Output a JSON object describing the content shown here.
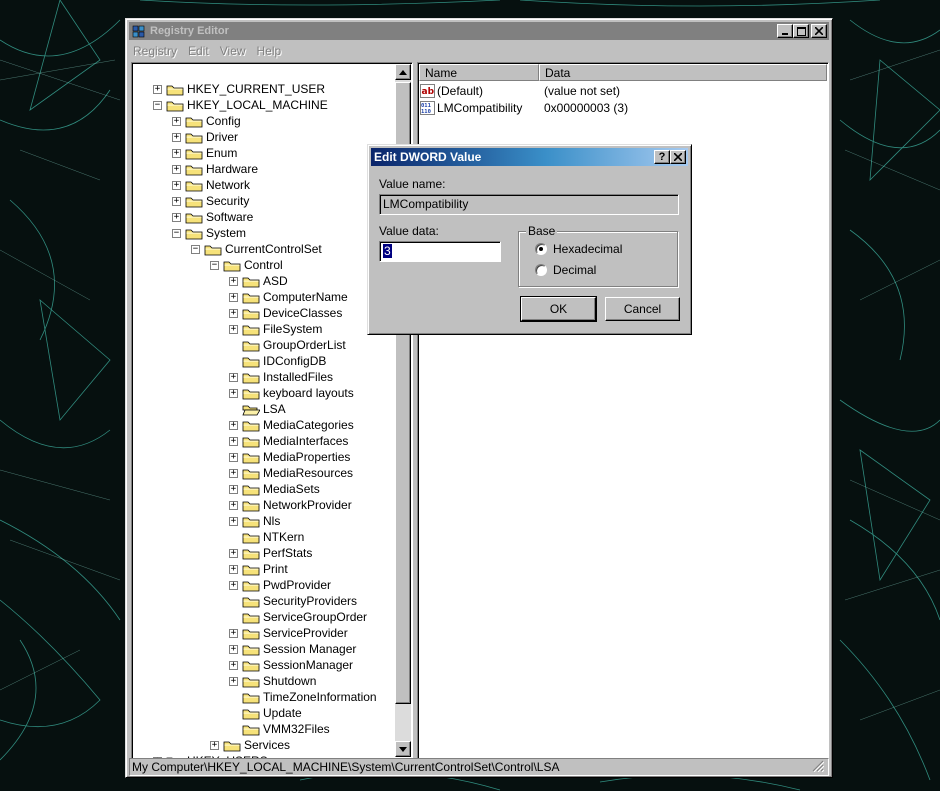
{
  "window": {
    "title": "Registry Editor",
    "menu": [
      "Registry",
      "Edit",
      "View",
      "Help"
    ]
  },
  "tree": {
    "items": [
      {
        "label": "HKEY_CURRENT_USER",
        "level": 0,
        "exp": "+"
      },
      {
        "label": "HKEY_LOCAL_MACHINE",
        "level": 0,
        "exp": "-"
      },
      {
        "label": "Config",
        "level": 1,
        "exp": "+"
      },
      {
        "label": "Driver",
        "level": 1,
        "exp": "+"
      },
      {
        "label": "Enum",
        "level": 1,
        "exp": "+"
      },
      {
        "label": "Hardware",
        "level": 1,
        "exp": "+"
      },
      {
        "label": "Network",
        "level": 1,
        "exp": "+"
      },
      {
        "label": "Security",
        "level": 1,
        "exp": "+"
      },
      {
        "label": "Software",
        "level": 1,
        "exp": "+"
      },
      {
        "label": "System",
        "level": 1,
        "exp": "-"
      },
      {
        "label": "CurrentControlSet",
        "level": 2,
        "exp": "-"
      },
      {
        "label": "Control",
        "level": 3,
        "exp": "-"
      },
      {
        "label": "ASD",
        "level": 4,
        "exp": "+"
      },
      {
        "label": "ComputerName",
        "level": 4,
        "exp": "+"
      },
      {
        "label": "DeviceClasses",
        "level": 4,
        "exp": "+"
      },
      {
        "label": "FileSystem",
        "level": 4,
        "exp": "+"
      },
      {
        "label": "GroupOrderList",
        "level": 4,
        "exp": ""
      },
      {
        "label": "IDConfigDB",
        "level": 4,
        "exp": ""
      },
      {
        "label": "InstalledFiles",
        "level": 4,
        "exp": "+"
      },
      {
        "label": "keyboard layouts",
        "level": 4,
        "exp": "+"
      },
      {
        "label": "LSA",
        "level": 4,
        "exp": "",
        "open": true
      },
      {
        "label": "MediaCategories",
        "level": 4,
        "exp": "+"
      },
      {
        "label": "MediaInterfaces",
        "level": 4,
        "exp": "+"
      },
      {
        "label": "MediaProperties",
        "level": 4,
        "exp": "+"
      },
      {
        "label": "MediaResources",
        "level": 4,
        "exp": "+"
      },
      {
        "label": "MediaSets",
        "level": 4,
        "exp": "+"
      },
      {
        "label": "NetworkProvider",
        "level": 4,
        "exp": "+"
      },
      {
        "label": "Nls",
        "level": 4,
        "exp": "+"
      },
      {
        "label": "NTKern",
        "level": 4,
        "exp": ""
      },
      {
        "label": "PerfStats",
        "level": 4,
        "exp": "+"
      },
      {
        "label": "Print",
        "level": 4,
        "exp": "+"
      },
      {
        "label": "PwdProvider",
        "level": 4,
        "exp": "+"
      },
      {
        "label": "SecurityProviders",
        "level": 4,
        "exp": ""
      },
      {
        "label": "ServiceGroupOrder",
        "level": 4,
        "exp": ""
      },
      {
        "label": "ServiceProvider",
        "level": 4,
        "exp": "+"
      },
      {
        "label": "Session Manager",
        "level": 4,
        "exp": "+"
      },
      {
        "label": "SessionManager",
        "level": 4,
        "exp": "+"
      },
      {
        "label": "Shutdown",
        "level": 4,
        "exp": "+"
      },
      {
        "label": "TimeZoneInformation",
        "level": 4,
        "exp": ""
      },
      {
        "label": "Update",
        "level": 4,
        "exp": ""
      },
      {
        "label": "VMM32Files",
        "level": 4,
        "exp": ""
      },
      {
        "label": "Services",
        "level": 3,
        "exp": "+"
      },
      {
        "label": "HKEY_USERS",
        "level": 0,
        "exp": "+"
      }
    ]
  },
  "list": {
    "headers": {
      "name": "Name",
      "data": "Data"
    },
    "rows": [
      {
        "icon": "string-value-icon",
        "name": "(Default)",
        "data": "(value not set)"
      },
      {
        "icon": "dword-value-icon",
        "name": "LMCompatibility",
        "data": "0x00000003 (3)"
      }
    ]
  },
  "status": {
    "path": "My Computer\\HKEY_LOCAL_MACHINE\\System\\CurrentControlSet\\Control\\LSA"
  },
  "dialog": {
    "title": "Edit DWORD Value",
    "help_glyph": "?",
    "close_glyph": "✕",
    "value_name_label": "Value name:",
    "value_name": "LMCompatibility",
    "value_data_label": "Value data:",
    "value_data": "3",
    "base_label": "Base",
    "hex_label": "Hexadecimal",
    "dec_label": "Decimal",
    "selected_base": "hex",
    "ok_label": "OK",
    "cancel_label": "Cancel"
  },
  "colors": {
    "desktop": "#06100f",
    "wire": "#3fb5a4",
    "dialog_title_start": "#0a246a",
    "dialog_title_end": "#a6caf0",
    "inactive_title": "#808080",
    "folder": "#f6e27a"
  }
}
